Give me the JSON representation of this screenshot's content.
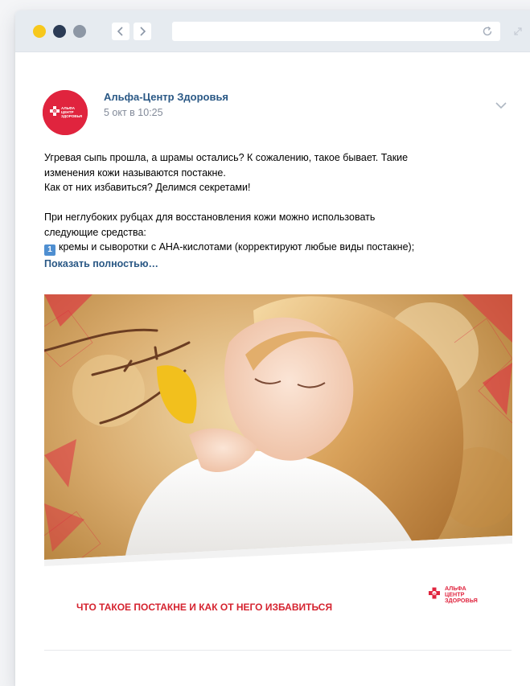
{
  "browser": {
    "back_icon": "chevron-left-icon",
    "forward_icon": "chevron-right-icon",
    "reload_icon": "reload-icon",
    "expand_icon": "expand-icon",
    "window_dot_colors": [
      "#f7c81c",
      "#2b3b55",
      "#8d97a5"
    ]
  },
  "post": {
    "author": "Альфа-Центр Здоровья",
    "date": "5 окт в 10:25",
    "avatar_logo": {
      "line1": "АЛЬФА",
      "line2": "ЦЕНТР",
      "line3": "ЗДОРОВЬЯ"
    },
    "lines": [
      "Угревая сыпь прошла, а шрамы остались? К сожалению, такое бывает. Такие",
      "изменения кожи называются постакне.",
      "Как от них избавиться? Делимся секретами!",
      "",
      "При неглубоких рубцах для восстановления кожи можно использовать",
      "следующие средства:"
    ],
    "list_item_number": "1",
    "list_item_text": "кремы и сыворотки с AHA-кислотами (корректируют любые виды постакне);",
    "show_more": "Показать полностью…",
    "image": {
      "caption": "ЧТО ТАКОЕ ПОСТАКНЕ И КАК ОТ НЕГО ИЗБАВИТЬСЯ",
      "logo_line1": "АЛЬФА",
      "logo_line2": "ЦЕНТР",
      "logo_line3": "ЗДОРОВЬЯ"
    },
    "colors": {
      "link": "#2a5885",
      "meta": "#828a99",
      "brand_red": "#e0243e",
      "caption_red": "#d5232f"
    }
  }
}
